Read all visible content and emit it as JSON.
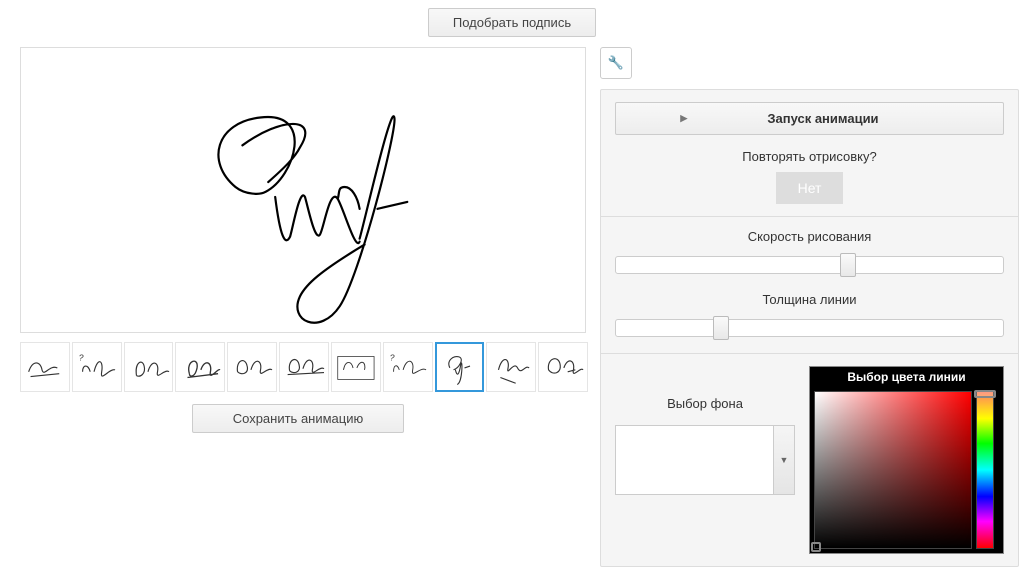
{
  "top_button": "Подобрать подпись",
  "save_button": "Сохранить анимацию",
  "animation": {
    "start_label": "Запуск анимации",
    "repeat_label": "Повторять отрисовку?",
    "repeat_value": "Нет"
  },
  "speed": {
    "label": "Скорость рисования",
    "value_pct": 58
  },
  "thickness": {
    "label": "Толщина линии",
    "value_pct": 25
  },
  "bg_label": "Выбор фона",
  "color_title": "Выбор цвета линии",
  "thumbs": {
    "selected_index": 8,
    "count": 11
  }
}
